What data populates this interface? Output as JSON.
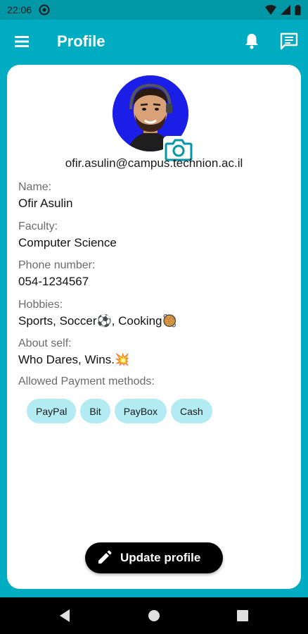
{
  "status": {
    "time": "22:06"
  },
  "app_bar": {
    "title": "Profile"
  },
  "profile": {
    "email": "ofir.asulin@campus.technion.ac.il",
    "fields": {
      "name": {
        "label": "Name:",
        "value": "Ofir Asulin"
      },
      "faculty": {
        "label": "Faculty:",
        "value": "Computer Science"
      },
      "phone": {
        "label": "Phone number:",
        "value": "054-1234567"
      },
      "hobbies": {
        "label": "Hobbies:",
        "value": "Sports, Soccer⚽, Cooking🥘"
      },
      "about": {
        "label": "About self:",
        "value": "Who Dares, Wins.💥"
      }
    },
    "payments": {
      "label": "Allowed Payment methods:",
      "methods": [
        "PayPal",
        "Bit",
        "PayBox",
        "Cash"
      ]
    }
  },
  "actions": {
    "update_label": "Update profile"
  },
  "colors": {
    "primary": "#00acc1",
    "status_bar": "#0097a7",
    "chip": "#b2ebf2",
    "avatar_bg": "#1a1ee6"
  },
  "icons": [
    "menu-icon",
    "bell-icon",
    "chat-icon",
    "camera-icon",
    "pencil-icon",
    "back-icon",
    "home-icon",
    "recents-icon"
  ]
}
